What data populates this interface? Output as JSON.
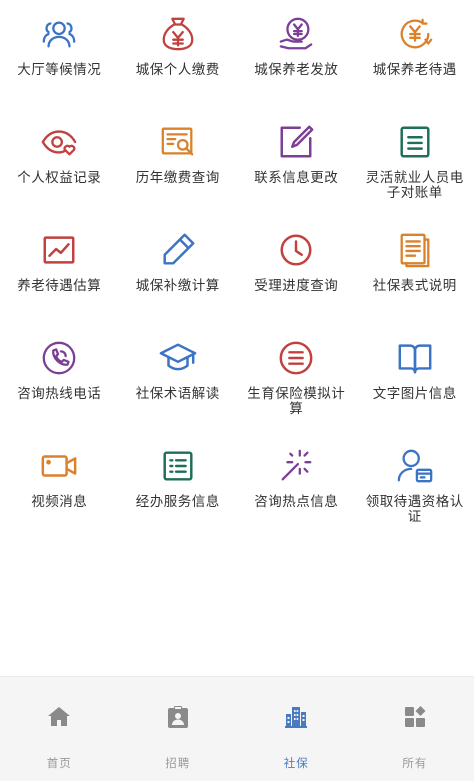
{
  "colors": {
    "blue": "#3b74c4",
    "red": "#c0413e",
    "purple": "#7b3f95",
    "orange": "#d9822b",
    "green": "#1f6e5a",
    "tab_inactive": "#8a8a8a",
    "tab_active": "#4a7bc0"
  },
  "grid": {
    "items": [
      {
        "label": "大厅等候情况",
        "icon": "people-icon"
      },
      {
        "label": "城保个人缴费",
        "icon": "money-bag-icon"
      },
      {
        "label": "城保养老发放",
        "icon": "yuan-hand-icon"
      },
      {
        "label": "城保养老待遇",
        "icon": "yuan-circle-arrow-icon"
      },
      {
        "label": "个人权益记录",
        "icon": "eye-heart-icon"
      },
      {
        "label": "历年缴费查询",
        "icon": "bill-search-icon"
      },
      {
        "label": "联系信息更改",
        "icon": "edit-square-icon"
      },
      {
        "label": "灵活就业人员电子对账单",
        "icon": "document-icon"
      },
      {
        "label": "养老待遇估算",
        "icon": "line-chart-icon"
      },
      {
        "label": "城保补缴计算",
        "icon": "pencil-icon"
      },
      {
        "label": "受理进度查询",
        "icon": "clock-icon"
      },
      {
        "label": "社保表式说明",
        "icon": "documents-icon"
      },
      {
        "label": "咨询热线电话",
        "icon": "phone-icon"
      },
      {
        "label": "社保术语解读",
        "icon": "graduation-cap-icon"
      },
      {
        "label": "生育保险模拟计算",
        "icon": "menu-circle-icon"
      },
      {
        "label": "文字图片信息",
        "icon": "open-book-icon"
      },
      {
        "label": "视频消息",
        "icon": "video-camera-icon"
      },
      {
        "label": "经办服务信息",
        "icon": "list-icon"
      },
      {
        "label": "咨询热点信息",
        "icon": "magic-wand-icon"
      },
      {
        "label": "领取待遇资格认证",
        "icon": "user-card-icon"
      }
    ]
  },
  "tabbar": {
    "tabs": [
      {
        "label": "首页",
        "icon": "home-icon"
      },
      {
        "label": "招聘",
        "icon": "clipboard-user-icon"
      },
      {
        "label": "社保",
        "icon": "buildings-icon",
        "active": true
      },
      {
        "label": "所有",
        "icon": "apps-icon"
      }
    ]
  }
}
